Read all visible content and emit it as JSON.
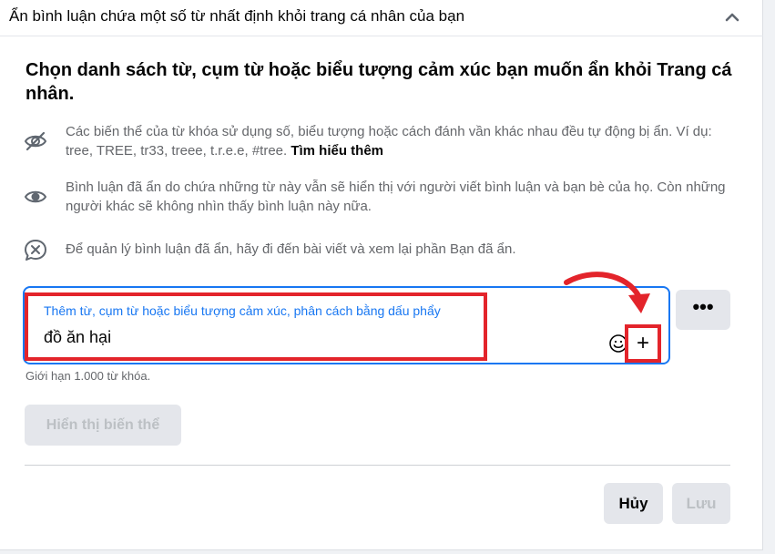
{
  "header": {
    "title": "Ẩn bình luận chứa một số từ nhất định khỏi trang cá nhân của bạn",
    "collapse_icon": "chevron-up-icon"
  },
  "main": {
    "heading": "Chọn danh sách từ, cụm từ hoặc biểu tượng cảm xúc bạn muốn ẩn khỏi Trang cá nhân.",
    "info": [
      {
        "icon": "eye-slash-icon",
        "text": "Các biến thể của từ khóa sử dụng số, biểu tượng hoặc cách đánh vần khác nhau đều tự động bị ẩn. Ví dụ: tree, TREE, tr33, treee, t.r.e.e, #tree.",
        "link": "Tìm hiểu thêm"
      },
      {
        "icon": "eye-icon",
        "text": "Bình luận đã ẩn do chứa những từ này vẫn sẽ hiển thị với người viết bình luận và bạn bè của họ. Còn những người khác sẽ không nhìn thấy bình luận này nữa."
      },
      {
        "icon": "comment-x-icon",
        "text": "Để quản lý bình luận đã ẩn, hãy đi đến bài viết và xem lại phần Bạn đã ẩn."
      }
    ],
    "keyword_input": {
      "label": "Thêm từ, cụm từ hoặc biểu tượng cảm xúc, phân cách bằng dấu phẩy",
      "value": "đồ ăn hại",
      "add_label": "+",
      "more_label": "•••"
    },
    "limit_note": "Giới hạn 1.000 từ khóa.",
    "show_variants_label": "Hiển thị biến thể"
  },
  "footer": {
    "cancel_label": "Hủy",
    "save_label": "Lưu"
  },
  "colors": {
    "accent": "#1877f2",
    "highlight_red": "#e3242b",
    "secondary_text": "#65676b",
    "disabled_text": "#bcc0c4",
    "button_bg": "#e4e6eb"
  }
}
